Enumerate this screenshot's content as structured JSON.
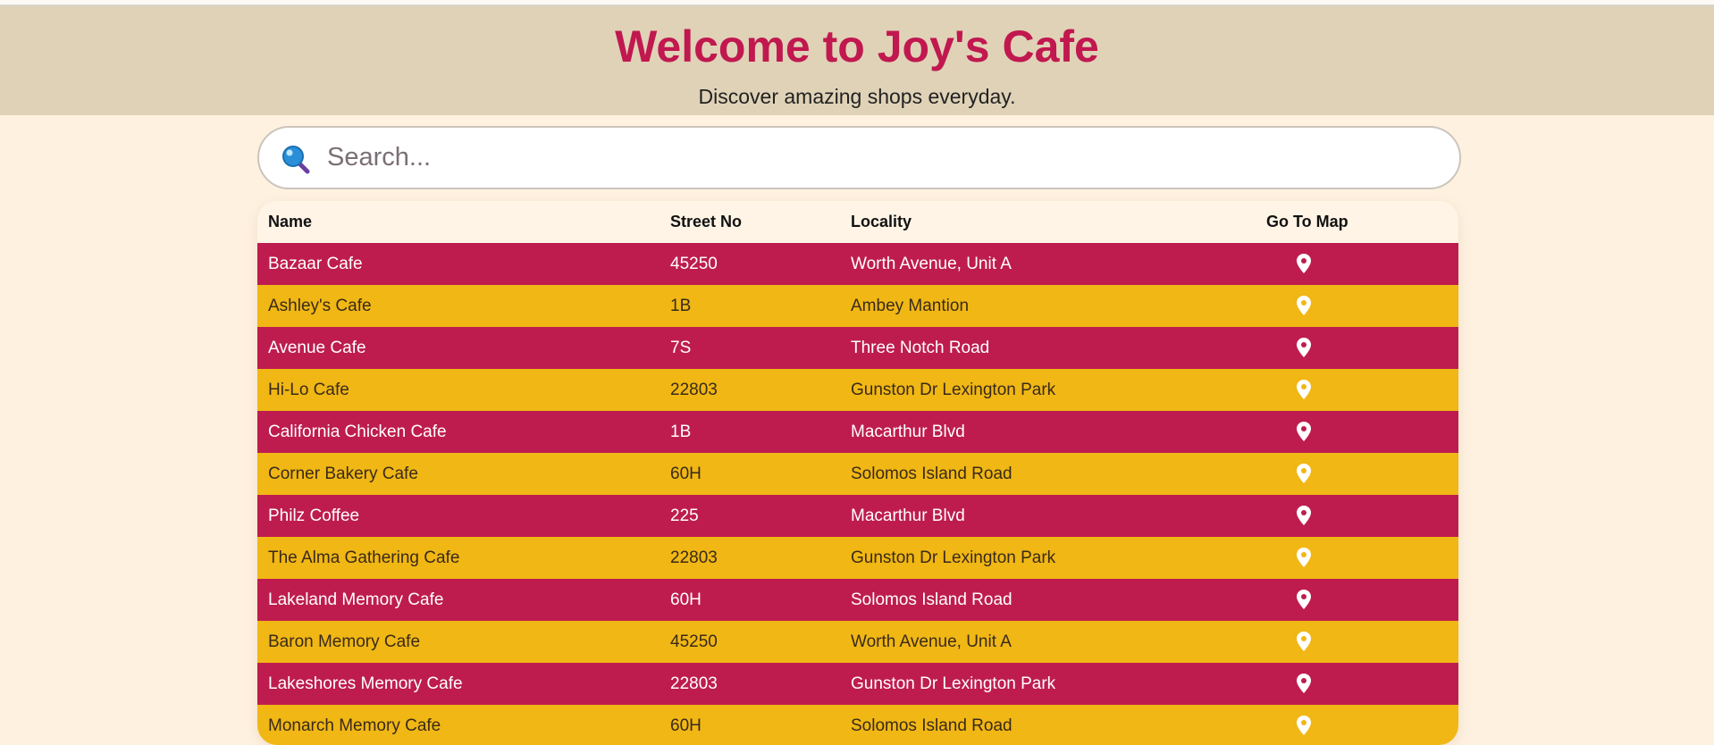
{
  "header": {
    "title": "Welcome to Joy's Cafe",
    "subtitle": "Discover amazing shops everyday."
  },
  "search": {
    "placeholder": "Search...",
    "icon": "magnifier-icon"
  },
  "table": {
    "columns": [
      "Name",
      "Street No",
      "Locality",
      "Go To Map"
    ],
    "rows": [
      {
        "name": "Bazaar Cafe",
        "street": "45250",
        "locality": "Worth Avenue, Unit A"
      },
      {
        "name": "Ashley's Cafe",
        "street": "1B",
        "locality": "Ambey Mantion"
      },
      {
        "name": "Avenue Cafe",
        "street": "7S",
        "locality": "Three Notch Road"
      },
      {
        "name": "Hi-Lo Cafe",
        "street": "22803",
        "locality": "Gunston Dr Lexington Park"
      },
      {
        "name": "California Chicken Cafe",
        "street": "1B",
        "locality": "Macarthur Blvd"
      },
      {
        "name": "Corner Bakery Cafe",
        "street": "60H",
        "locality": "Solomos Island Road"
      },
      {
        "name": "Philz Coffee",
        "street": "225",
        "locality": "Macarthur Blvd"
      },
      {
        "name": "The Alma Gathering Cafe",
        "street": "22803",
        "locality": "Gunston Dr Lexington Park"
      },
      {
        "name": "Lakeland Memory Cafe",
        "street": "60H",
        "locality": "Solomos Island Road"
      },
      {
        "name": "Baron Memory Cafe",
        "street": "45250",
        "locality": "Worth Avenue, Unit A"
      },
      {
        "name": "Lakeshores Memory Cafe",
        "street": "22803",
        "locality": "Gunston Dr Lexington Park"
      },
      {
        "name": "Monarch Memory Cafe",
        "street": "60H",
        "locality": "Solomos Island Road"
      }
    ]
  },
  "colors": {
    "title": "#c0184f",
    "header_bg": "#e0d2b7",
    "page_bg": "#fff1e0",
    "row_odd": "#be1c4f",
    "row_even": "#f0b715"
  }
}
